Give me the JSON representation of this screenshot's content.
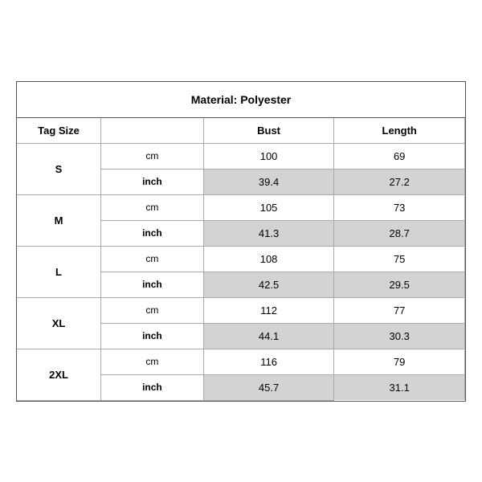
{
  "title": "Material: Polyester",
  "headers": {
    "tag_size": "Tag Size",
    "bust": "Bust",
    "length": "Length"
  },
  "rows": [
    {
      "size": "S",
      "cm": {
        "bust": "100",
        "length": "69"
      },
      "inch": {
        "bust": "39.4",
        "length": "27.2"
      }
    },
    {
      "size": "M",
      "cm": {
        "bust": "105",
        "length": "73"
      },
      "inch": {
        "bust": "41.3",
        "length": "28.7"
      }
    },
    {
      "size": "L",
      "cm": {
        "bust": "108",
        "length": "75"
      },
      "inch": {
        "bust": "42.5",
        "length": "29.5"
      }
    },
    {
      "size": "XL",
      "cm": {
        "bust": "112",
        "length": "77"
      },
      "inch": {
        "bust": "44.1",
        "length": "30.3"
      }
    },
    {
      "size": "2XL",
      "cm": {
        "bust": "116",
        "length": "79"
      },
      "inch": {
        "bust": "45.7",
        "length": "31.1"
      }
    }
  ],
  "units": {
    "cm": "cm",
    "inch": "inch"
  }
}
